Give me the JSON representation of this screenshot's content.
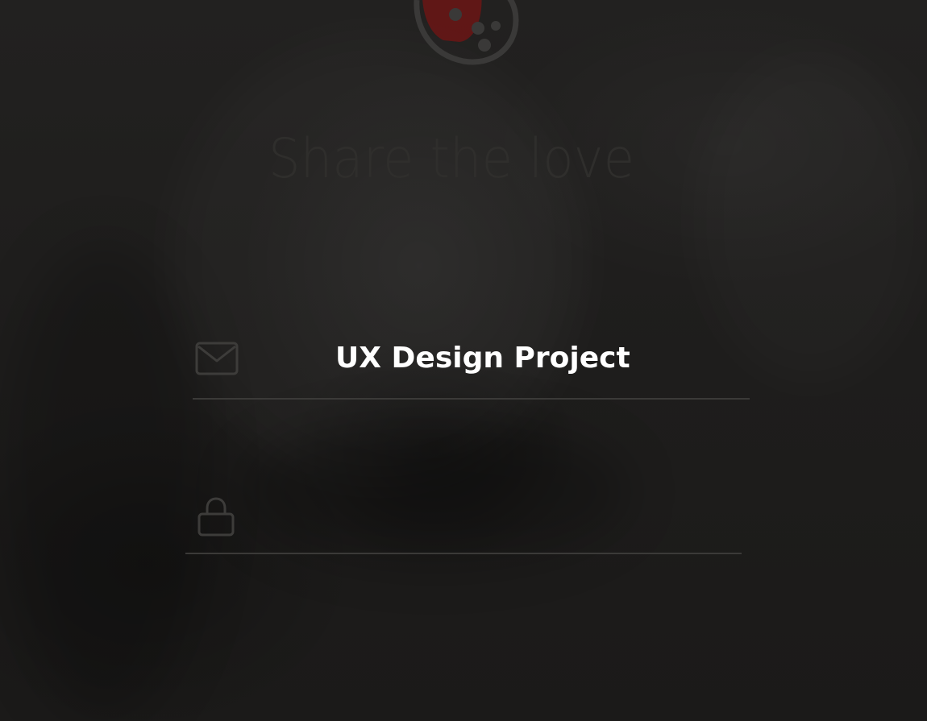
{
  "app": {
    "headline": "Share the love"
  },
  "login_form": {
    "email": {
      "icon": "mail-icon",
      "value": "UX Design Project"
    },
    "password": {
      "icon": "lock-icon",
      "value": ""
    }
  },
  "colors": {
    "background": "#1c1b1a",
    "headline": "#2f2e2c",
    "divider": "#3b3a38",
    "icon_stroke": "#3d3c3a",
    "logo_red": "#7a1616",
    "text": "#ffffff"
  }
}
